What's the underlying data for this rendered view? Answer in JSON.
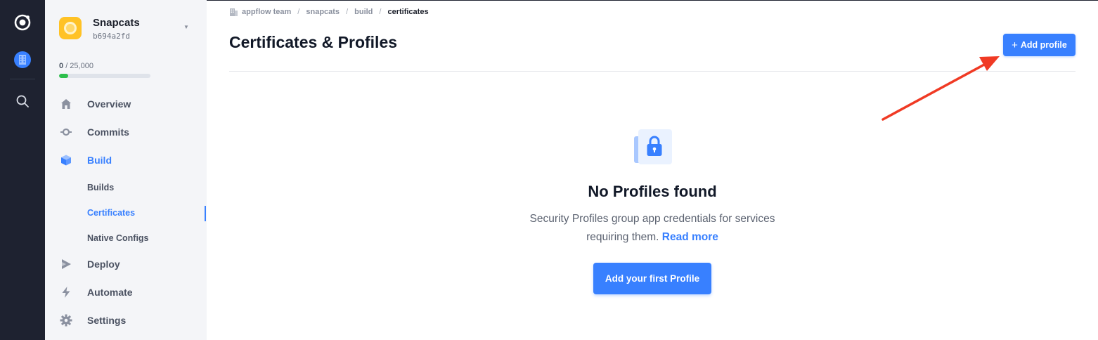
{
  "rail": {
    "items": [
      {
        "icon": "ionic-logo-icon"
      },
      {
        "icon": "organization-icon"
      },
      {
        "icon": "search-icon"
      }
    ]
  },
  "app": {
    "name": "Snapcats",
    "id": "b694a2fd"
  },
  "usage": {
    "used": "0",
    "total": "/ 25,000",
    "fraction": 0.1
  },
  "nav": {
    "items": [
      {
        "label": "Overview",
        "icon": "home-icon"
      },
      {
        "label": "Commits",
        "icon": "commit-icon"
      },
      {
        "label": "Build",
        "icon": "cube-icon",
        "active": true
      },
      {
        "label": "Deploy",
        "icon": "deploy-icon"
      },
      {
        "label": "Automate",
        "icon": "bolt-icon"
      },
      {
        "label": "Settings",
        "icon": "gear-icon"
      }
    ],
    "build_sub": [
      {
        "label": "Builds"
      },
      {
        "label": "Certificates",
        "active": true
      },
      {
        "label": "Native Configs"
      }
    ]
  },
  "breadcrumb": [
    "appflow team",
    "snapcats",
    "build",
    "certificates"
  ],
  "page": {
    "title": "Certificates & Profiles",
    "add_button": "Add profile",
    "add_button_icon": "plus-icon"
  },
  "empty": {
    "icon": "lock-icon",
    "title": "No Profiles found",
    "desc_line1": "Security Profiles group app credentials for services",
    "desc_line2": "requiring them.",
    "read_more": "Read more",
    "cta": "Add your first Profile"
  },
  "colors": {
    "accent": "#3880ff",
    "rail_bg": "#1e2230",
    "sidebar_bg": "#f4f5f8",
    "annotation_arrow": "#f03a24",
    "usage_fill": "#2dbf4c"
  }
}
